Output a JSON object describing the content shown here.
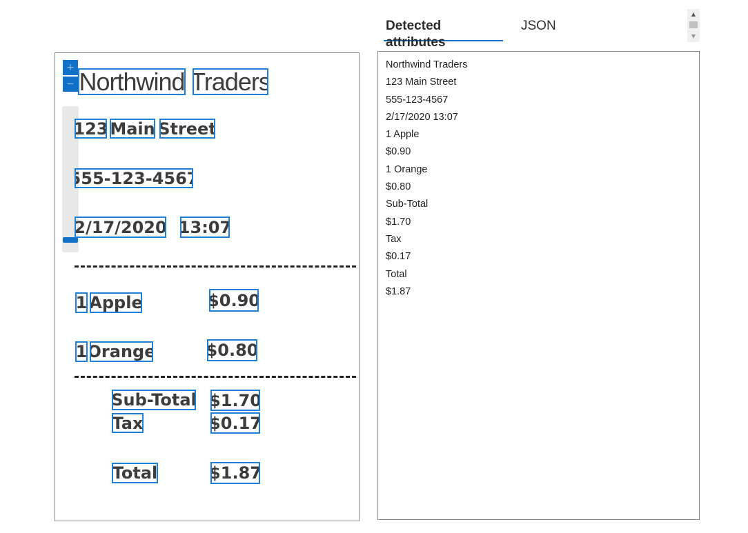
{
  "tabs": [
    {
      "label": "Detected attributes",
      "active": true
    },
    {
      "label": "JSON",
      "active": false
    }
  ],
  "zoom": {
    "in_label": "+",
    "out_label": "−"
  },
  "receipt": {
    "words": [
      {
        "text": "Northwind",
        "style": "hdr"
      },
      {
        "text": "Traders",
        "style": "hdr"
      },
      {
        "text": "123",
        "style": "std"
      },
      {
        "text": "Main",
        "style": "std"
      },
      {
        "text": "Street",
        "style": "std"
      },
      {
        "text": "555-123-4567",
        "style": "std"
      },
      {
        "text": "2/17/2020",
        "style": "std"
      },
      {
        "text": "13:07",
        "style": "std"
      },
      {
        "text": "1",
        "style": "std"
      },
      {
        "text": "Apple",
        "style": "std"
      },
      {
        "text": "$0.90",
        "style": "std"
      },
      {
        "text": "1",
        "style": "std"
      },
      {
        "text": "Orange",
        "style": "std"
      },
      {
        "text": "$0.80",
        "style": "std"
      },
      {
        "text": "Sub-Total",
        "style": "std"
      },
      {
        "text": "$1.70",
        "style": "std"
      },
      {
        "text": "Tax",
        "style": "std"
      },
      {
        "text": "$0.17",
        "style": "std"
      },
      {
        "text": "Total",
        "style": "std"
      },
      {
        "text": "$1.87",
        "style": "std"
      }
    ]
  },
  "results": [
    "Northwind Traders",
    "123 Main Street",
    "555-123-4567",
    "2/17/2020 13:07",
    "1 Apple",
    "$0.90",
    "1 Orange",
    "$0.80",
    "Sub-Total",
    "$1.70",
    "Tax",
    "$0.17",
    "Total",
    "$1.87"
  ],
  "colors": {
    "accent": "#1171c9",
    "box": "#1e7fd6"
  }
}
